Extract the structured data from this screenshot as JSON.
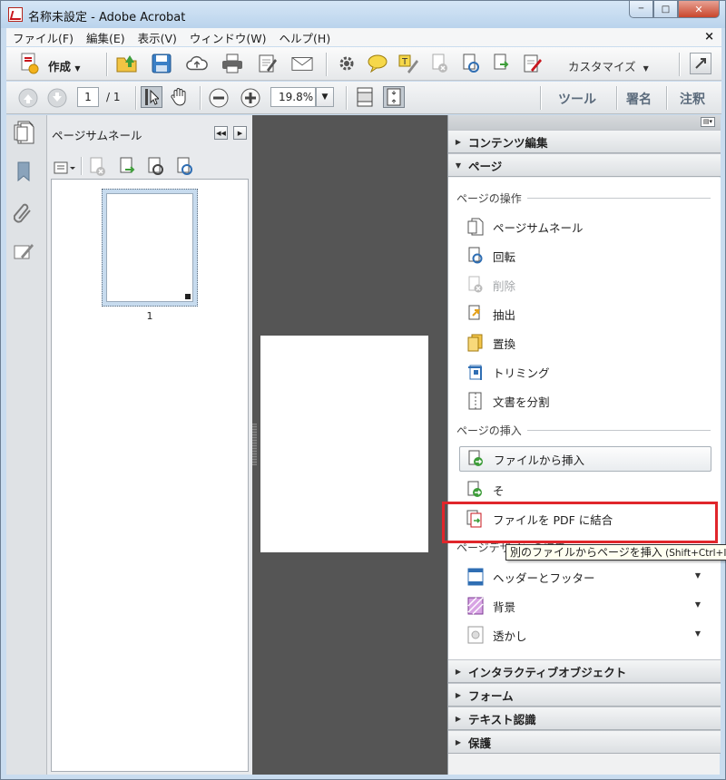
{
  "window": {
    "title": "名称未設定 - Adobe Acrobat",
    "controls": {
      "minimize": "─",
      "maximize": "□",
      "close": "✕"
    }
  },
  "menubar": {
    "items": [
      "ファイル(F)",
      "編集(E)",
      "表示(V)",
      "ウィンドウ(W)",
      "ヘルプ(H)"
    ],
    "close_doc": "×"
  },
  "toolbar": {
    "create_label": "作成",
    "customize_label": "カスタマイズ",
    "dropdown_arrow": "▼"
  },
  "navbar": {
    "page_current": "1",
    "page_total": "/ 1",
    "zoom": "19.8%",
    "links": [
      "ツール",
      "署名",
      "注釈"
    ]
  },
  "thumbnails": {
    "title": "ページサムネール",
    "page_number": "1"
  },
  "taskpane": {
    "sections_top": [
      {
        "label": "コンテンツ編集",
        "arrow": "▶"
      },
      {
        "label": "ページ",
        "arrow": "▼"
      }
    ],
    "groups": {
      "page_ops": "ページの操作",
      "insert": "ページの挿入",
      "design": "ページデザインの編集"
    },
    "page_ops_items": [
      "ページサムネール",
      "回転",
      "削除",
      "抽出",
      "置換",
      "トリミング",
      "文書を分割"
    ],
    "insert_items": [
      "ファイルから挿入",
      "そ",
      "ファイルを PDF に結合"
    ],
    "design_items": [
      "ヘッダーとフッター",
      "背景",
      "透かし"
    ],
    "sections_bottom": [
      {
        "label": "インタラクティブオブジェクト",
        "arrow": "▶"
      },
      {
        "label": "フォーム",
        "arrow": "▶"
      },
      {
        "label": "テキスト認識",
        "arrow": "▶"
      },
      {
        "label": "保護",
        "arrow": "▶"
      }
    ],
    "tooltip": {
      "text": "別のファイルからページを挿入",
      "shortcut": " (Shift+Ctrl+I)"
    }
  },
  "colors": {
    "highlight": "#e0262b",
    "acrobat_red": "#c8161d",
    "doc_background": "#555555"
  }
}
